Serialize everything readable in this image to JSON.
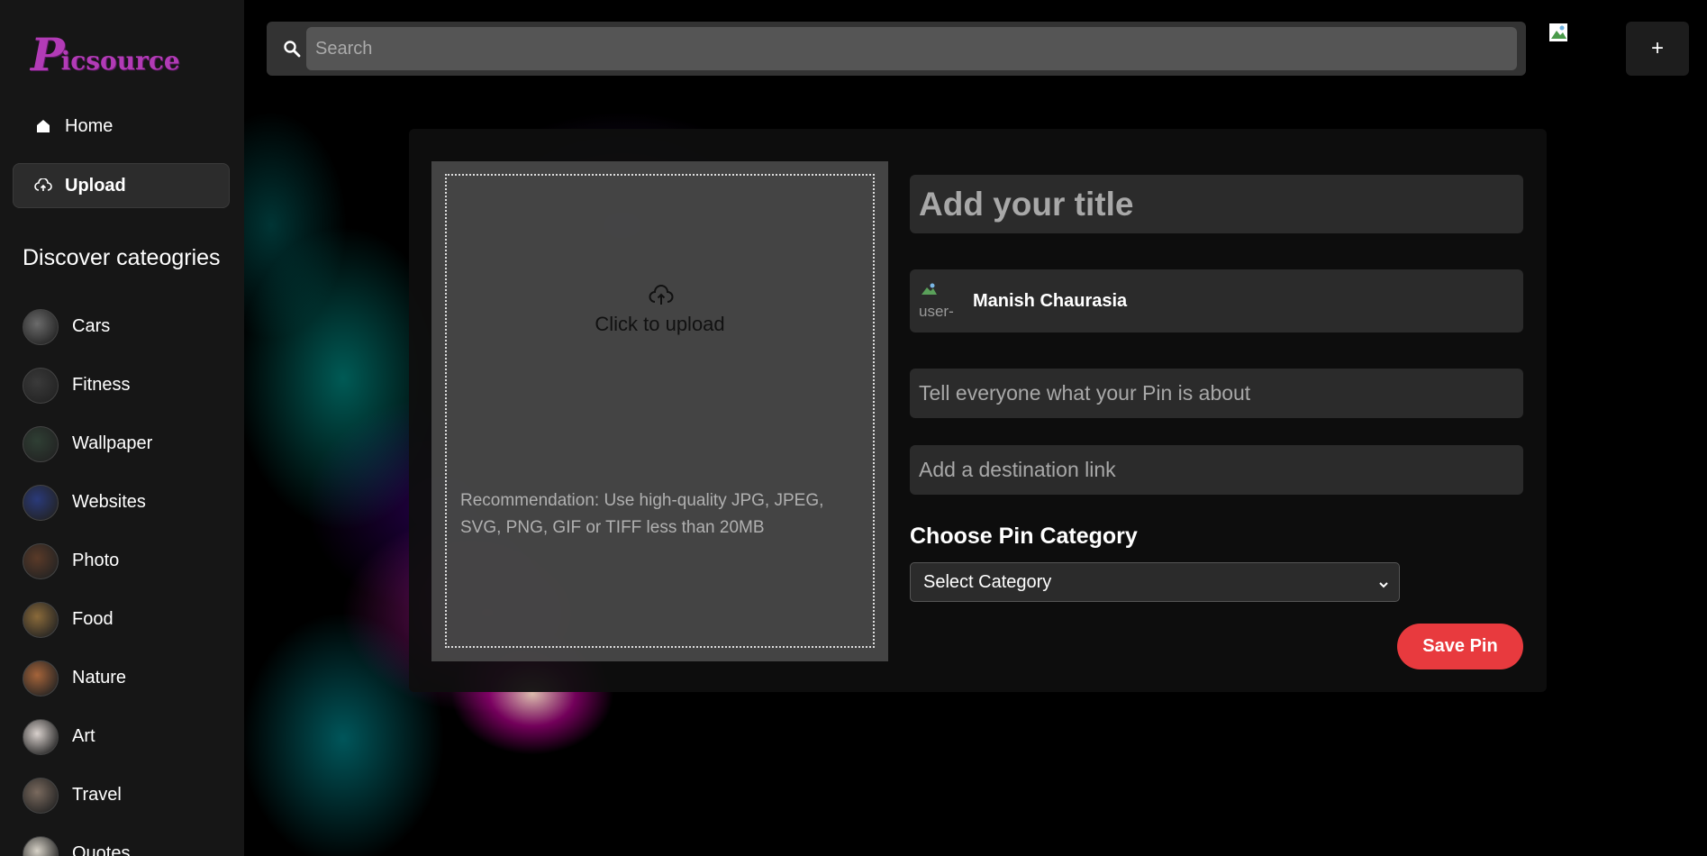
{
  "brand": {
    "logo_letter": "P",
    "logo_rest": "icsource"
  },
  "nav": {
    "home_label": "Home",
    "upload_label": "Upload"
  },
  "discover": {
    "heading": "Discover cateogries",
    "categories": [
      {
        "label": "Cars",
        "thumb_color": "#6b6b6b"
      },
      {
        "label": "Fitness",
        "thumb_color": "#3a3a3a"
      },
      {
        "label": "Wallpaper",
        "thumb_color": "#2f3f34"
      },
      {
        "label": "Websites",
        "thumb_color": "#2a3a7a"
      },
      {
        "label": "Photo",
        "thumb_color": "#5a3a28"
      },
      {
        "label": "Food",
        "thumb_color": "#8a6a3a"
      },
      {
        "label": "Nature",
        "thumb_color": "#a5643a"
      },
      {
        "label": "Art",
        "thumb_color": "#d8d0cc"
      },
      {
        "label": "Travel",
        "thumb_color": "#7a6a5e"
      },
      {
        "label": "Quotes",
        "thumb_color": "#d7d2c7"
      }
    ]
  },
  "topbar": {
    "search_placeholder": "Search",
    "plus_label": "+"
  },
  "create": {
    "upload_text": "Click to upload",
    "recommendation": "Recommendation: Use high-quality JPG, JPEG, SVG, PNG, GIF or TIFF less than 20MB",
    "title_placeholder": "Add your title",
    "user_name": "Manish Chaurasia",
    "user_avatar_alt": "user-",
    "about_placeholder": "Tell everyone what your Pin is about",
    "link_placeholder": "Add a destination link",
    "category_heading": "Choose Pin Category",
    "category_selected": "Select Category",
    "save_label": "Save Pin"
  },
  "colors": {
    "brand": "#b23bb6",
    "save_button": "#e83a3e",
    "sidebar_bg": "#161616",
    "field_bg": "#2b2b2b"
  },
  "icons": {
    "home": "home-icon",
    "upload": "cloud-upload-icon",
    "search": "search-icon",
    "chevron": "chevron-down-icon"
  }
}
